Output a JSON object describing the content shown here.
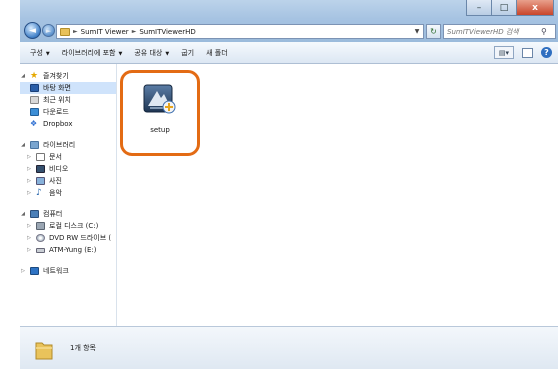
{
  "window": {
    "controls": {
      "minimize": "–",
      "maximize": "□",
      "close": "x"
    }
  },
  "address": {
    "crumbs": [
      "SumIT Viewer",
      "SumITViewerHD"
    ],
    "separator": "►"
  },
  "search": {
    "placeholder": "SumITViewerHD 검색"
  },
  "toolbar": {
    "organize": "구성",
    "include_in_library": "라이브러리에 포함",
    "share_with": "공유 대상",
    "burn": "굽기",
    "new_folder": "새 폴더"
  },
  "nav": {
    "favorites": {
      "label": "즐겨찾기",
      "items": [
        "바탕 화면",
        "최근 위치",
        "다운로드",
        "Dropbox"
      ]
    },
    "libraries": {
      "label": "라이브러리",
      "items": [
        "문서",
        "비디오",
        "사진",
        "음악"
      ]
    },
    "computer": {
      "label": "컴퓨터",
      "items": [
        "로컬 디스크 (C:)",
        "DVD RW 드라이브 (",
        "ATM-Yung (E:)"
      ]
    },
    "network": {
      "label": "네트워크"
    }
  },
  "content": {
    "files": [
      {
        "name": "setup"
      }
    ]
  },
  "status": {
    "count": "1개 항목"
  },
  "colors": {
    "highlight": "#e36b14",
    "title_glass": "#a6c3e2",
    "selected": "#cfe3fb"
  }
}
